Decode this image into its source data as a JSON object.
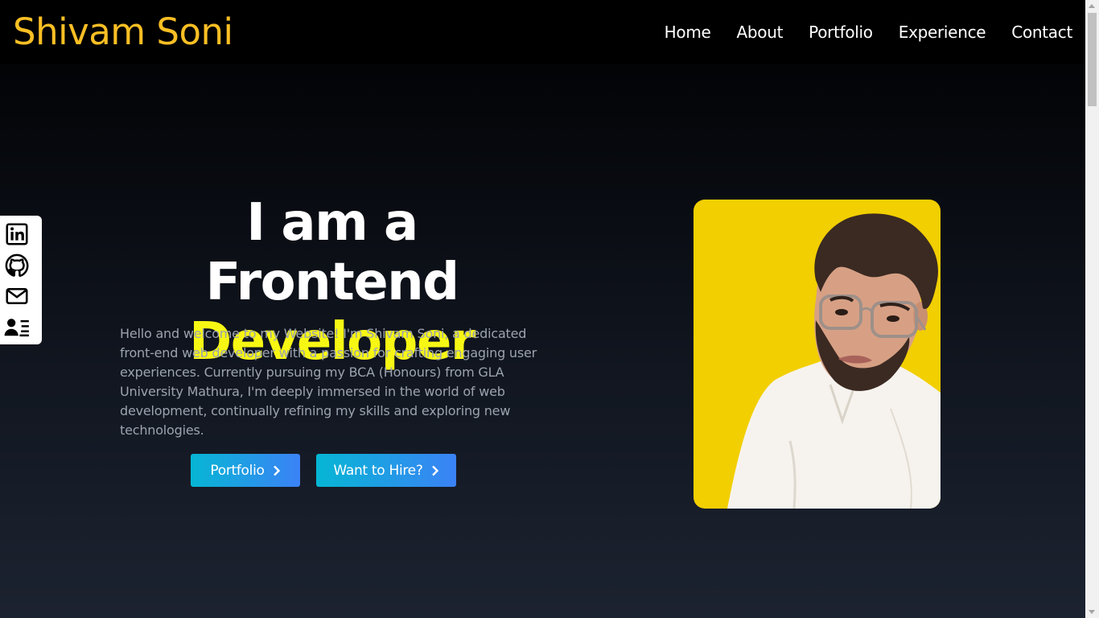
{
  "header": {
    "brand": "Shivam Soni",
    "nav": [
      "Home",
      "About",
      "Portfolio",
      "Experience",
      "Contact"
    ]
  },
  "social": {
    "icons": [
      "linkedin-icon",
      "github-icon",
      "mail-icon",
      "resume-icon"
    ]
  },
  "hero": {
    "title_line1": "I am a Frontend",
    "title_line2": "Developer",
    "intro": "Hello and welcome to my Website! I'm Shivam Soni, a dedicated front-end web developer with a passion for crafting engaging user experiences. Currently pursuing my BCA (Honours) from GLA University Mathura, I'm deeply immersed in the world of web development, continually refining my skills and exploring new technologies.",
    "primary_button": "Portfolio",
    "secondary_button": "Want to Hire?"
  },
  "colors": {
    "brand": "#fbbf24",
    "highlight": "#f7f714",
    "button_start": "#06b6d4",
    "button_end": "#3b82f6",
    "photo_bg": "#f2cf00"
  }
}
